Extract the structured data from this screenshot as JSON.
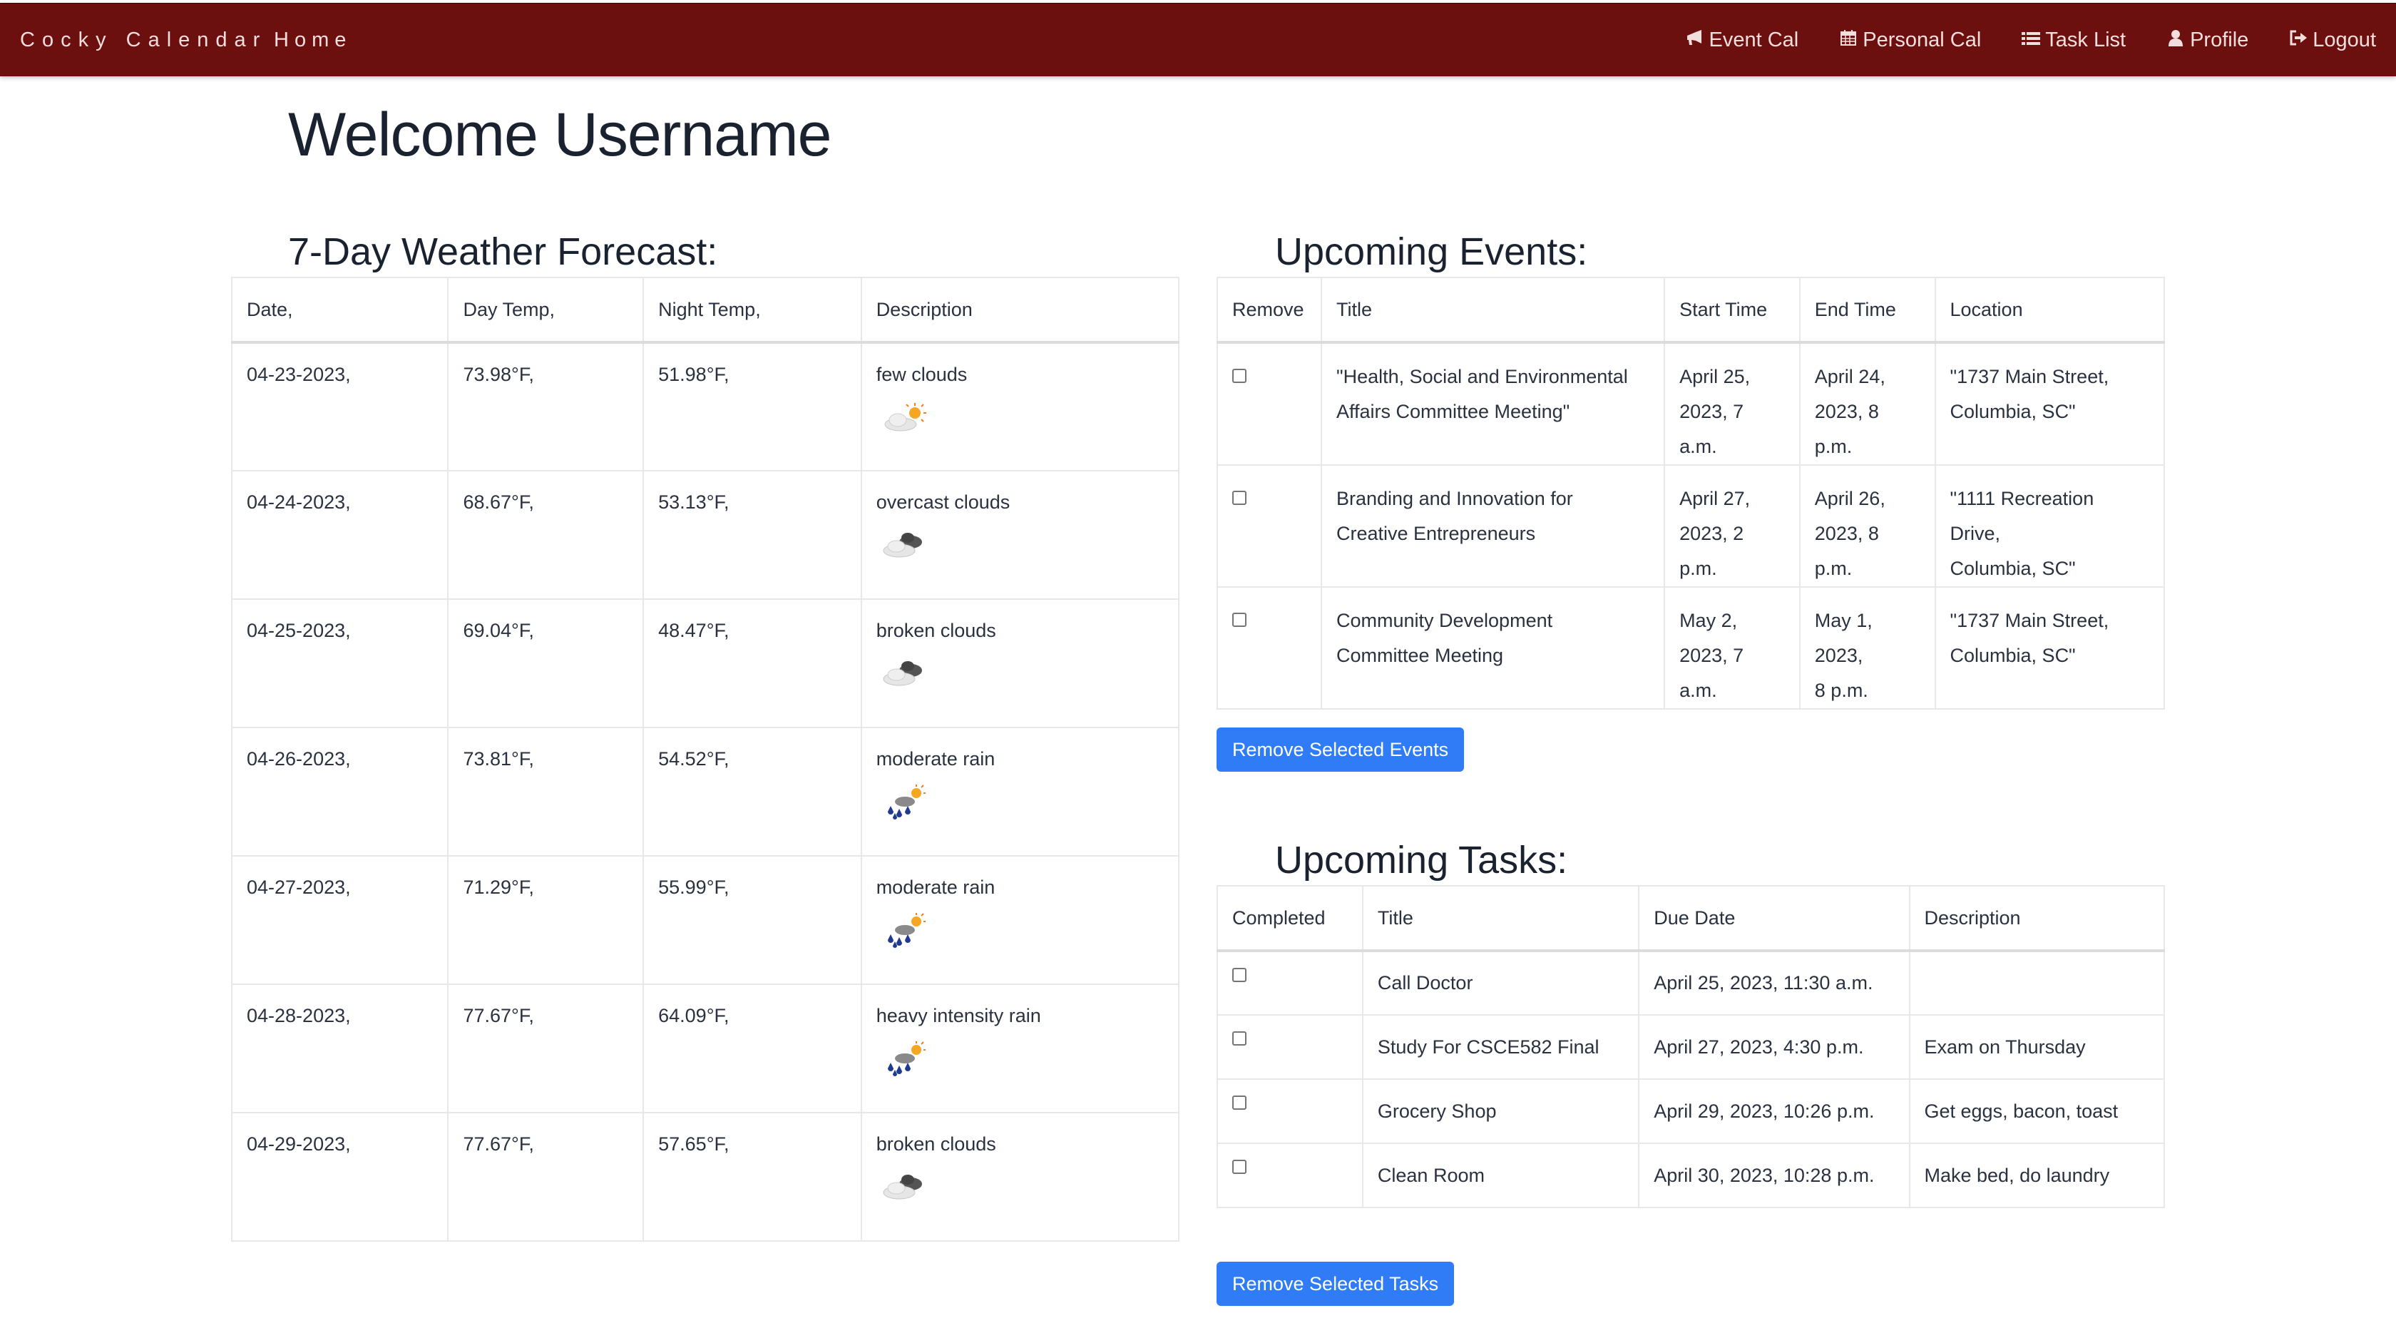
{
  "nav": {
    "brand": "Cocky Calendar",
    "home": "Home",
    "items": [
      {
        "label": "Event Cal",
        "icon": "bullhorn-icon"
      },
      {
        "label": "Personal Cal",
        "icon": "calendar-icon"
      },
      {
        "label": "Task List",
        "icon": "list-icon"
      },
      {
        "label": "Profile",
        "icon": "user-icon"
      },
      {
        "label": "Logout",
        "icon": "logout-icon"
      }
    ]
  },
  "welcome": "Welcome Username",
  "weather": {
    "title": "7-Day Weather Forecast:",
    "headers": [
      "Date,",
      "Day Temp,",
      "Night Temp,",
      "Description"
    ],
    "rows": [
      {
        "date": "04-23-2023,",
        "day": "73.98°F,",
        "night": "51.98°F,",
        "desc": "few clouds",
        "icon": "few-clouds-icon"
      },
      {
        "date": "04-24-2023,",
        "day": "68.67°F,",
        "night": "53.13°F,",
        "desc": "overcast clouds",
        "icon": "overcast-clouds-icon"
      },
      {
        "date": "04-25-2023,",
        "day": "69.04°F,",
        "night": "48.47°F,",
        "desc": "broken clouds",
        "icon": "broken-clouds-icon"
      },
      {
        "date": "04-26-2023,",
        "day": "73.81°F,",
        "night": "54.52°F,",
        "desc": "moderate rain",
        "icon": "rain-icon"
      },
      {
        "date": "04-27-2023,",
        "day": "71.29°F,",
        "night": "55.99°F,",
        "desc": "moderate rain",
        "icon": "rain-icon"
      },
      {
        "date": "04-28-2023,",
        "day": "77.67°F,",
        "night": "64.09°F,",
        "desc": "heavy intensity rain",
        "icon": "rain-icon"
      },
      {
        "date": "04-29-2023,",
        "day": "77.67°F,",
        "night": "57.65°F,",
        "desc": "broken clouds",
        "icon": "broken-clouds-icon"
      }
    ]
  },
  "events": {
    "title": "Upcoming Events:",
    "headers": [
      "Remove",
      "Title",
      "Start Time",
      "End Time",
      "Location"
    ],
    "rows": [
      {
        "title1": "\"Health, Social and Environmental",
        "title2": "Affairs Committee Meeting\"",
        "start1": "April 25,",
        "start2": "2023, 7 a.m.",
        "end1": "April 24,",
        "end2": "2023, 8 p.m.",
        "loc1": "\"1737 Main Street,",
        "loc2": "Columbia, SC\""
      },
      {
        "title1": "Branding and Innovation for",
        "title2": "Creative Entrepreneurs",
        "start1": "April 27,",
        "start2": "2023, 2 p.m.",
        "end1": "April 26,",
        "end2": "2023, 8 p.m.",
        "loc1": "\"1111 Recreation Drive,",
        "loc2": "Columbia, SC\""
      },
      {
        "title1": "Community Development",
        "title2": "Committee Meeting",
        "start1": "May 2,",
        "start2": "2023, 7 a.m.",
        "end1": "May 1, 2023,",
        "end2": "8 p.m.",
        "loc1": "\"1737 Main Street,",
        "loc2": "Columbia, SC\""
      }
    ],
    "button": "Remove Selected Events"
  },
  "tasks": {
    "title": "Upcoming Tasks:",
    "headers": [
      "Completed",
      "Title",
      "Due Date",
      "Description"
    ],
    "rows": [
      {
        "title": "Call Doctor",
        "due": "April 25, 2023, 11:30 a.m.",
        "desc": ""
      },
      {
        "title": "Study For CSCE582 Final",
        "due": "April 27, 2023, 4:30 p.m.",
        "desc": "Exam on Thursday"
      },
      {
        "title": "Grocery Shop",
        "due": "April 29, 2023, 10:26 p.m.",
        "desc": "Get eggs, bacon, toast"
      },
      {
        "title": "Clean Room",
        "due": "April 30, 2023, 10:28 p.m.",
        "desc": "Make bed, do laundry"
      }
    ],
    "button": "Remove Selected Tasks"
  }
}
